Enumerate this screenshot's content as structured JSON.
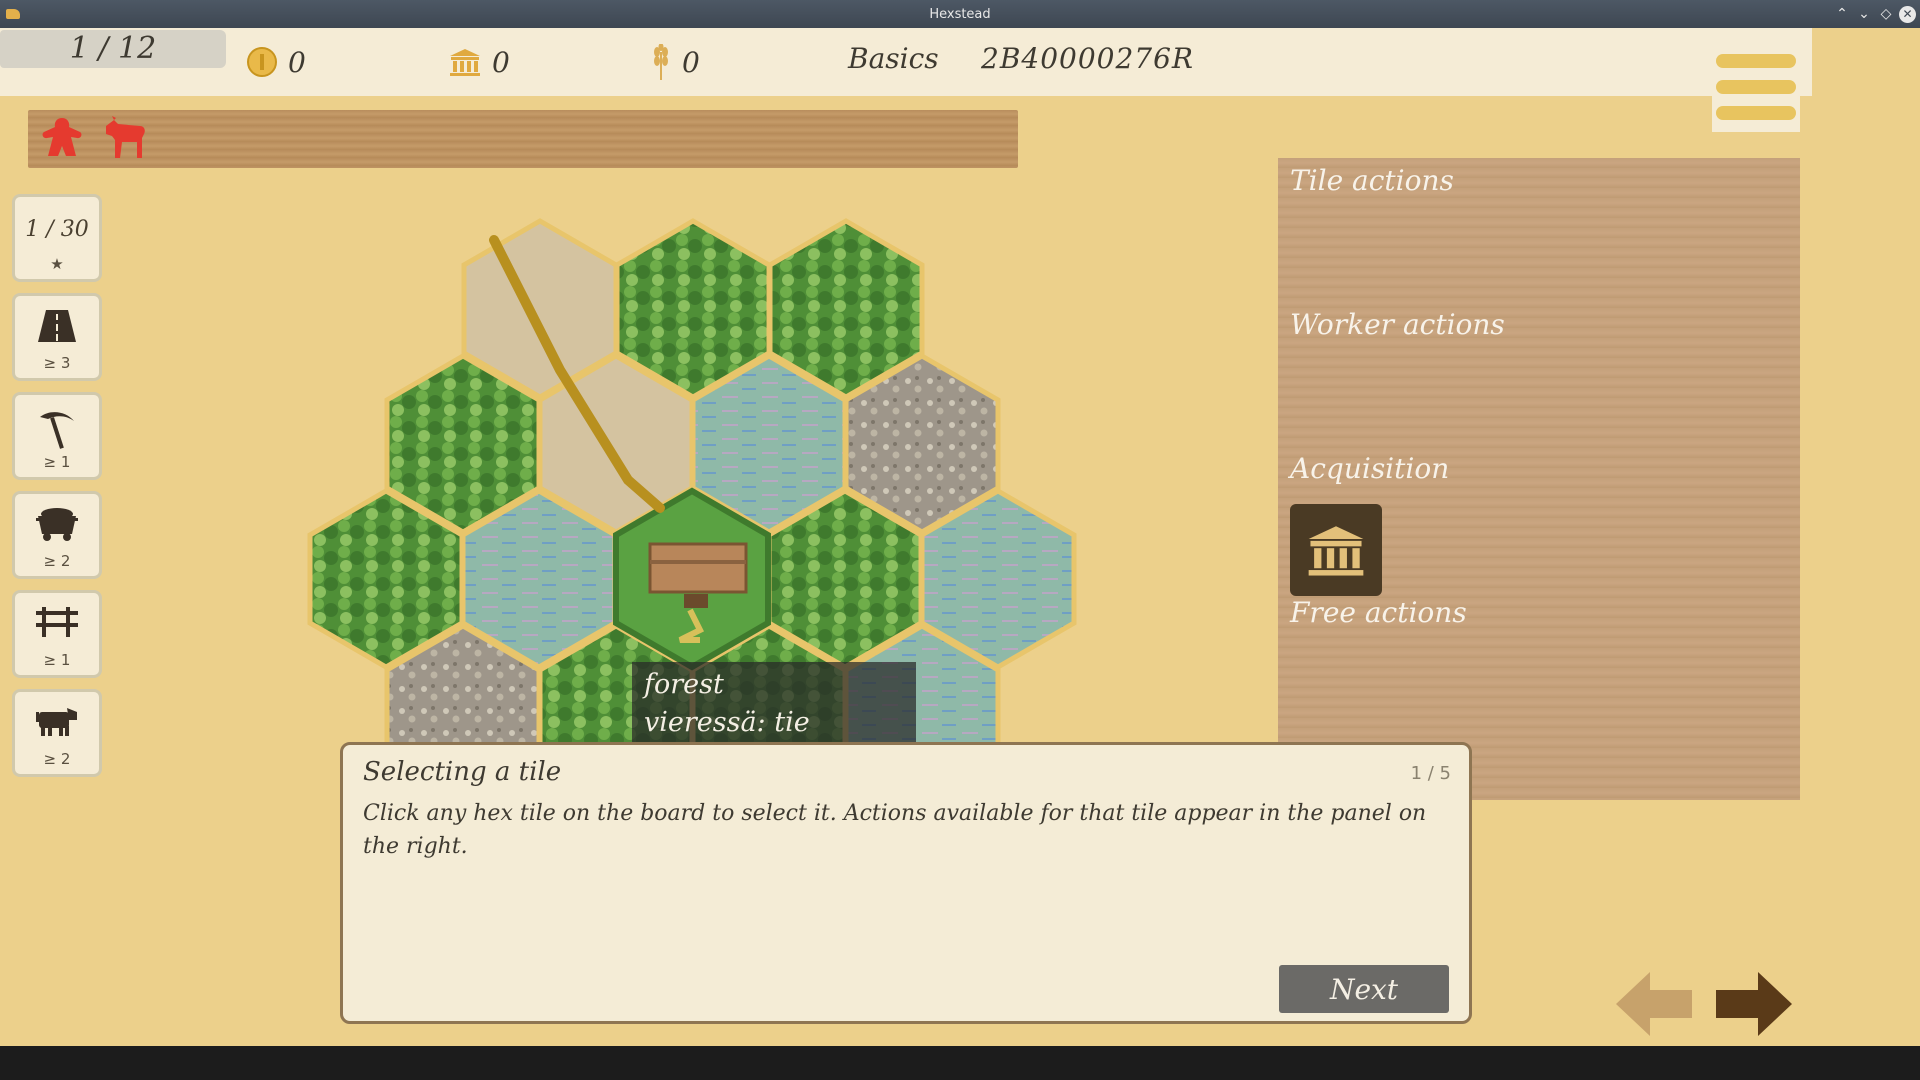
{
  "window": {
    "title": "Hexstead"
  },
  "topbar": {
    "turn": "1 / 12",
    "coins": "0",
    "buildings": "0",
    "grain": "0",
    "mode": "Basics",
    "seed": "2B40000276R"
  },
  "goals": [
    {
      "label": "★",
      "count": "1 / 30",
      "icon": "star-goal"
    },
    {
      "label": "≥ 3",
      "icon": "road-icon"
    },
    {
      "label": "≥ 1",
      "icon": "pickaxe-icon"
    },
    {
      "label": "≥ 2",
      "icon": "mine-cart-icon"
    },
    {
      "label": "≥ 1",
      "icon": "fence-icon"
    },
    {
      "label": "≥ 2",
      "icon": "cow-icon"
    }
  ],
  "tooltip": {
    "tile_type": "forest",
    "adjacent": "vieressä: tie"
  },
  "panel": {
    "tile_actions": "Tile actions",
    "worker_actions": "Worker actions",
    "acquisition": "Acquisition",
    "free_actions": "Free actions"
  },
  "tutorial": {
    "title": "Selecting a tile",
    "page": "1 / 5",
    "body": "Click any hex tile on the board to select it. Actions available for that tile appear in the panel on the right.",
    "next_label": "Next"
  },
  "colors": {
    "background": "#ecd08b",
    "player_red": "#e53a2f",
    "forest": "#5a9a3e",
    "water": "#8fb9a8",
    "rock": "#9e968a",
    "road_tile": "#d4c3a0",
    "road": "#b8901f",
    "wood_panel": "#c4a07a"
  }
}
